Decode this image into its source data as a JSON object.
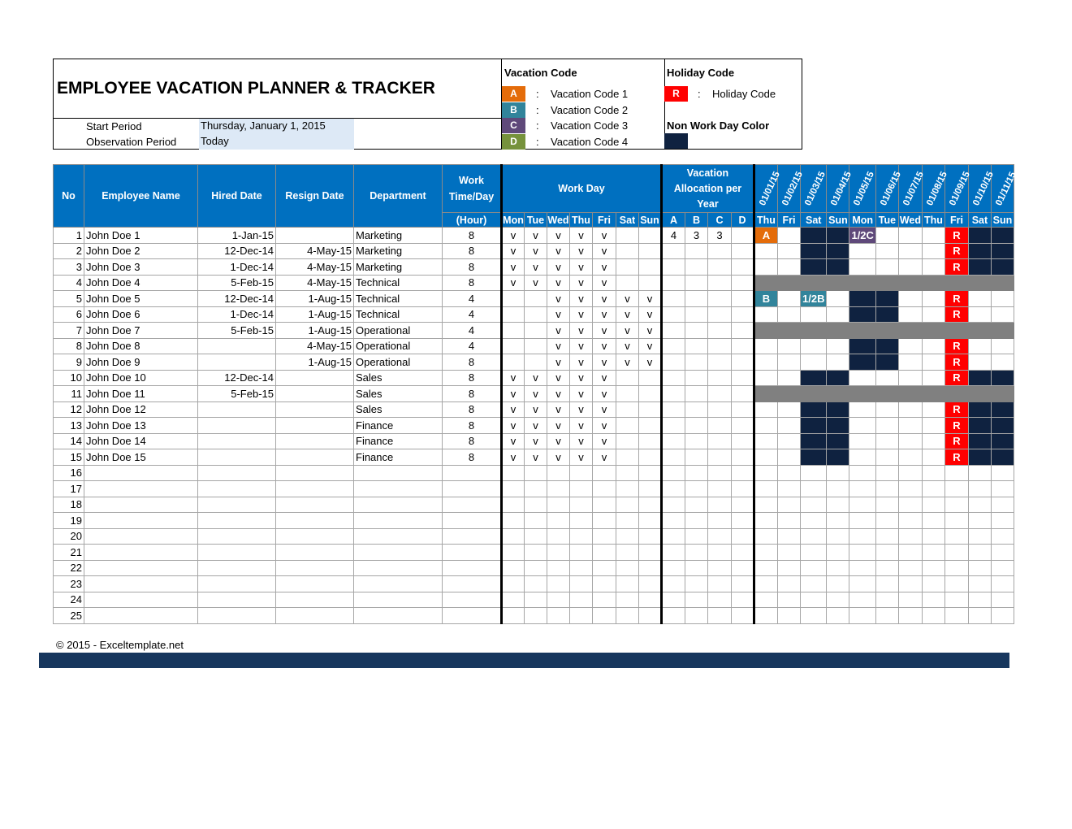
{
  "header": {
    "title": "EMPLOYEE VACATION PLANNER & TRACKER",
    "start_period_label": "Start Period",
    "start_period_value": "Thursday, January 1, 2015",
    "observation_period_label": "Observation Period",
    "observation_period_value": "Today"
  },
  "legend": {
    "vacation_title": "Vacation Code",
    "vacation_codes": [
      {
        "code": "A",
        "label": "Vacation Code 1",
        "color": "#e46c0a"
      },
      {
        "code": "B",
        "label": "Vacation Code 2",
        "color": "#31849b"
      },
      {
        "code": "C",
        "label": "Vacation Code 3",
        "color": "#5f497a"
      },
      {
        "code": "D",
        "label": "Vacation Code 4",
        "color": "#76923c"
      }
    ],
    "holiday_title": "Holiday Code",
    "holiday_code": {
      "code": "R",
      "label": "Holiday Code",
      "color": "#ff0000"
    },
    "nonwork_title": "Non Work Day Color",
    "nonwork_color": "#0f2240",
    "colon": ":"
  },
  "table": {
    "headers": {
      "no": "No",
      "name": "Employee Name",
      "hired": "Hired Date",
      "resign": "Resign Date",
      "dept": "Department",
      "worktime": "Work Time/Day",
      "worktime_unit": "(Hour)",
      "workday": "Work Day",
      "allocation": "Vacation Allocation per Year"
    },
    "weekdays": [
      "Mon",
      "Tue",
      "Wed",
      "Thu",
      "Fri",
      "Sat",
      "Sun"
    ],
    "alloc_codes": [
      "A",
      "B",
      "C",
      "D"
    ],
    "dates": [
      "01/01/15",
      "01/02/15",
      "01/03/15",
      "01/04/15",
      "01/05/15",
      "01/06/15",
      "01/07/15",
      "01/08/15",
      "01/09/15",
      "01/10/15",
      "01/11/15"
    ],
    "date_days": [
      "Thu",
      "Fri",
      "Sat",
      "Sun",
      "Mon",
      "Tue",
      "Wed",
      "Thu",
      "Fri",
      "Sat",
      "Sun"
    ],
    "rows": [
      {
        "no": "1",
        "name": "John Doe 1",
        "hired": "1-Jan-15",
        "resign": "",
        "dept": "Marketing",
        "hours": "8",
        "days": [
          "v",
          "v",
          "v",
          "v",
          "v",
          "",
          ""
        ],
        "alloc": [
          "4",
          "3",
          "3",
          ""
        ],
        "cal": [
          "A",
          "",
          "N",
          "N",
          "1/2C",
          "",
          "",
          "",
          "R",
          "N",
          "N"
        ]
      },
      {
        "no": "2",
        "name": "John Doe 2",
        "hired": "12-Dec-14",
        "resign": "4-May-15",
        "dept": "Marketing",
        "hours": "8",
        "days": [
          "v",
          "v",
          "v",
          "v",
          "v",
          "",
          ""
        ],
        "alloc": [
          "",
          "",
          "",
          ""
        ],
        "cal": [
          "",
          "",
          "N",
          "N",
          "",
          "",
          "",
          "",
          "R",
          "N",
          "N"
        ]
      },
      {
        "no": "3",
        "name": "John Doe 3",
        "hired": "1-Dec-14",
        "resign": "4-May-15",
        "dept": "Marketing",
        "hours": "8",
        "days": [
          "v",
          "v",
          "v",
          "v",
          "v",
          "",
          ""
        ],
        "alloc": [
          "",
          "",
          "",
          ""
        ],
        "cal": [
          "",
          "",
          "N",
          "N",
          "",
          "",
          "",
          "",
          "R",
          "N",
          "N"
        ]
      },
      {
        "no": "4",
        "name": "John Doe 4",
        "hired": "5-Feb-15",
        "resign": "4-May-15",
        "dept": "Technical",
        "hours": "8",
        "days": [
          "v",
          "v",
          "v",
          "v",
          "v",
          "",
          ""
        ],
        "alloc": [
          "",
          "",
          "",
          ""
        ],
        "cal": "inactive"
      },
      {
        "no": "5",
        "name": "John Doe 5",
        "hired": "12-Dec-14",
        "resign": "1-Aug-15",
        "dept": "Technical",
        "hours": "4",
        "days": [
          "",
          "",
          "v",
          "v",
          "v",
          "v",
          "v"
        ],
        "alloc": [
          "",
          "",
          "",
          ""
        ],
        "cal": [
          "B",
          "",
          "1/2B",
          "",
          "N",
          "N",
          "",
          "",
          "R",
          "",
          ""
        ]
      },
      {
        "no": "6",
        "name": "John Doe 6",
        "hired": "1-Dec-14",
        "resign": "1-Aug-15",
        "dept": "Technical",
        "hours": "4",
        "days": [
          "",
          "",
          "v",
          "v",
          "v",
          "v",
          "v"
        ],
        "alloc": [
          "",
          "",
          "",
          ""
        ],
        "cal": [
          "",
          "",
          "",
          "",
          "N",
          "N",
          "",
          "",
          "R",
          "",
          ""
        ]
      },
      {
        "no": "7",
        "name": "John Doe 7",
        "hired": "5-Feb-15",
        "resign": "1-Aug-15",
        "dept": "Operational",
        "hours": "4",
        "days": [
          "",
          "",
          "v",
          "v",
          "v",
          "v",
          "v"
        ],
        "alloc": [
          "",
          "",
          "",
          ""
        ],
        "cal": "inactive"
      },
      {
        "no": "8",
        "name": "John Doe 8",
        "hired": "",
        "resign": "4-May-15",
        "dept": "Operational",
        "hours": "4",
        "days": [
          "",
          "",
          "v",
          "v",
          "v",
          "v",
          "v"
        ],
        "alloc": [
          "",
          "",
          "",
          ""
        ],
        "cal": [
          "",
          "",
          "",
          "",
          "N",
          "N",
          "",
          "",
          "R",
          "",
          ""
        ]
      },
      {
        "no": "9",
        "name": "John Doe 9",
        "hired": "",
        "resign": "1-Aug-15",
        "dept": "Operational",
        "hours": "8",
        "days": [
          "",
          "",
          "v",
          "v",
          "v",
          "v",
          "v"
        ],
        "alloc": [
          "",
          "",
          "",
          ""
        ],
        "cal": [
          "",
          "",
          "",
          "",
          "N",
          "N",
          "",
          "",
          "R",
          "",
          ""
        ]
      },
      {
        "no": "10",
        "name": "John Doe 10",
        "hired": "12-Dec-14",
        "resign": "",
        "dept": "Sales",
        "hours": "8",
        "days": [
          "v",
          "v",
          "v",
          "v",
          "v",
          "",
          ""
        ],
        "alloc": [
          "",
          "",
          "",
          ""
        ],
        "cal": [
          "",
          "",
          "N",
          "N",
          "",
          "",
          "",
          "",
          "R",
          "N",
          "N"
        ]
      },
      {
        "no": "11",
        "name": "John Doe 11",
        "hired": "5-Feb-15",
        "resign": "",
        "dept": "Sales",
        "hours": "8",
        "days": [
          "v",
          "v",
          "v",
          "v",
          "v",
          "",
          ""
        ],
        "alloc": [
          "",
          "",
          "",
          ""
        ],
        "cal": "inactive"
      },
      {
        "no": "12",
        "name": "John Doe 12",
        "hired": "",
        "resign": "",
        "dept": "Sales",
        "hours": "8",
        "days": [
          "v",
          "v",
          "v",
          "v",
          "v",
          "",
          ""
        ],
        "alloc": [
          "",
          "",
          "",
          ""
        ],
        "cal": [
          "",
          "",
          "N",
          "N",
          "",
          "",
          "",
          "",
          "R",
          "N",
          "N"
        ]
      },
      {
        "no": "13",
        "name": "John Doe 13",
        "hired": "",
        "resign": "",
        "dept": "Finance",
        "hours": "8",
        "days": [
          "v",
          "v",
          "v",
          "v",
          "v",
          "",
          ""
        ],
        "alloc": [
          "",
          "",
          "",
          ""
        ],
        "cal": [
          "",
          "",
          "N",
          "N",
          "",
          "",
          "",
          "",
          "R",
          "N",
          "N"
        ]
      },
      {
        "no": "14",
        "name": "John Doe 14",
        "hired": "",
        "resign": "",
        "dept": "Finance",
        "hours": "8",
        "days": [
          "v",
          "v",
          "v",
          "v",
          "v",
          "",
          ""
        ],
        "alloc": [
          "",
          "",
          "",
          ""
        ],
        "cal": [
          "",
          "",
          "N",
          "N",
          "",
          "",
          "",
          "",
          "R",
          "N",
          "N"
        ]
      },
      {
        "no": "15",
        "name": "John Doe 15",
        "hired": "",
        "resign": "",
        "dept": "Finance",
        "hours": "8",
        "days": [
          "v",
          "v",
          "v",
          "v",
          "v",
          "",
          ""
        ],
        "alloc": [
          "",
          "",
          "",
          ""
        ],
        "cal": [
          "",
          "",
          "N",
          "N",
          "",
          "",
          "",
          "",
          "R",
          "N",
          "N"
        ]
      },
      {
        "no": "16",
        "name": "",
        "hired": "",
        "resign": "",
        "dept": "",
        "hours": "",
        "days": [
          "",
          "",
          "",
          "",
          "",
          "",
          ""
        ],
        "alloc": [
          "",
          "",
          "",
          ""
        ],
        "cal": [
          "",
          "",
          "",
          "",
          "",
          "",
          "",
          "",
          "",
          "",
          ""
        ]
      },
      {
        "no": "17",
        "name": "",
        "hired": "",
        "resign": "",
        "dept": "",
        "hours": "",
        "days": [
          "",
          "",
          "",
          "",
          "",
          "",
          ""
        ],
        "alloc": [
          "",
          "",
          "",
          ""
        ],
        "cal": [
          "",
          "",
          "",
          "",
          "",
          "",
          "",
          "",
          "",
          "",
          ""
        ]
      },
      {
        "no": "18",
        "name": "",
        "hired": "",
        "resign": "",
        "dept": "",
        "hours": "",
        "days": [
          "",
          "",
          "",
          "",
          "",
          "",
          ""
        ],
        "alloc": [
          "",
          "",
          "",
          ""
        ],
        "cal": [
          "",
          "",
          "",
          "",
          "",
          "",
          "",
          "",
          "",
          "",
          ""
        ]
      },
      {
        "no": "19",
        "name": "",
        "hired": "",
        "resign": "",
        "dept": "",
        "hours": "",
        "days": [
          "",
          "",
          "",
          "",
          "",
          "",
          ""
        ],
        "alloc": [
          "",
          "",
          "",
          ""
        ],
        "cal": [
          "",
          "",
          "",
          "",
          "",
          "",
          "",
          "",
          "",
          "",
          ""
        ]
      },
      {
        "no": "20",
        "name": "",
        "hired": "",
        "resign": "",
        "dept": "",
        "hours": "",
        "days": [
          "",
          "",
          "",
          "",
          "",
          "",
          ""
        ],
        "alloc": [
          "",
          "",
          "",
          ""
        ],
        "cal": [
          "",
          "",
          "",
          "",
          "",
          "",
          "",
          "",
          "",
          "",
          ""
        ]
      },
      {
        "no": "21",
        "name": "",
        "hired": "",
        "resign": "",
        "dept": "",
        "hours": "",
        "days": [
          "",
          "",
          "",
          "",
          "",
          "",
          ""
        ],
        "alloc": [
          "",
          "",
          "",
          ""
        ],
        "cal": [
          "",
          "",
          "",
          "",
          "",
          "",
          "",
          "",
          "",
          "",
          ""
        ]
      },
      {
        "no": "22",
        "name": "",
        "hired": "",
        "resign": "",
        "dept": "",
        "hours": "",
        "days": [
          "",
          "",
          "",
          "",
          "",
          "",
          ""
        ],
        "alloc": [
          "",
          "",
          "",
          ""
        ],
        "cal": [
          "",
          "",
          "",
          "",
          "",
          "",
          "",
          "",
          "",
          "",
          ""
        ]
      },
      {
        "no": "23",
        "name": "",
        "hired": "",
        "resign": "",
        "dept": "",
        "hours": "",
        "days": [
          "",
          "",
          "",
          "",
          "",
          "",
          ""
        ],
        "alloc": [
          "",
          "",
          "",
          ""
        ],
        "cal": [
          "",
          "",
          "",
          "",
          "",
          "",
          "",
          "",
          "",
          "",
          ""
        ]
      },
      {
        "no": "24",
        "name": "",
        "hired": "",
        "resign": "",
        "dept": "",
        "hours": "",
        "days": [
          "",
          "",
          "",
          "",
          "",
          "",
          ""
        ],
        "alloc": [
          "",
          "",
          "",
          ""
        ],
        "cal": [
          "",
          "",
          "",
          "",
          "",
          "",
          "",
          "",
          "",
          "",
          ""
        ]
      },
      {
        "no": "25",
        "name": "",
        "hired": "",
        "resign": "",
        "dept": "",
        "hours": "",
        "days": [
          "",
          "",
          "",
          "",
          "",
          "",
          ""
        ],
        "alloc": [
          "",
          "",
          "",
          ""
        ],
        "cal": [
          "",
          "",
          "",
          "",
          "",
          "",
          "",
          "",
          "",
          "",
          ""
        ]
      }
    ]
  },
  "footer": {
    "copyright": "© 2015 - Exceltemplate.net"
  }
}
